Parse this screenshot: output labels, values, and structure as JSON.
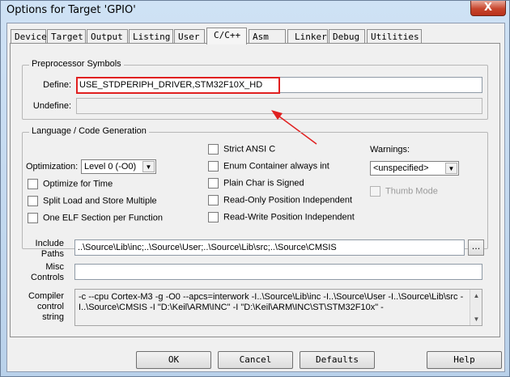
{
  "window": {
    "title": "Options for Target 'GPIO'",
    "close_glyph": "X"
  },
  "tabs": [
    {
      "label": "Device"
    },
    {
      "label": "Target"
    },
    {
      "label": "Output"
    },
    {
      "label": "Listing"
    },
    {
      "label": "User"
    },
    {
      "label": "C/C++",
      "active": true
    },
    {
      "label": "Asm"
    },
    {
      "label": "Linker"
    },
    {
      "label": "Debug"
    },
    {
      "label": "Utilities"
    }
  ],
  "preprocessor": {
    "legend": "Preprocessor Symbols",
    "define_label": "Define:",
    "define_value": "USE_STDPERIPH_DRIVER,STM32F10X_HD",
    "undefine_label": "Undefine:",
    "undefine_value": ""
  },
  "language": {
    "legend": "Language / Code Generation",
    "optimization_label": "Optimization:",
    "optimization_value": "Level 0 (-O0)",
    "optimize_time": "Optimize for Time",
    "split_load": "Split Load and Store Multiple",
    "one_elf": "One ELF Section per Function",
    "strict_ansi": "Strict ANSI C",
    "enum_container": "Enum Container always int",
    "plain_char": "Plain Char is Signed",
    "ro_pi": "Read-Only Position Independent",
    "rw_pi": "Read-Write Position Independent",
    "warnings_label": "Warnings:",
    "warnings_value": "<unspecified>",
    "thumb_mode": "Thumb Mode"
  },
  "include": {
    "label_line1": "Include",
    "label_line2": "Paths",
    "value": "..\\Source\\Lib\\inc;..\\Source\\User;..\\Source\\Lib\\src;..\\Source\\CMSIS",
    "browse_label": "..."
  },
  "misc": {
    "label_line1": "Misc",
    "label_line2": "Controls",
    "value": ""
  },
  "compiler": {
    "label_line1": "Compiler",
    "label_line2": "control",
    "label_line3": "string",
    "line1": "-c --cpu Cortex-M3 -g -O0 --apcs=interwork -I..\\Source\\Lib\\inc -I..\\Source\\User -I..\\Source\\Lib\\src -",
    "line2": "I..\\Source\\CMSIS -I \"D:\\Keil\\ARM\\INC\" -I \"D:\\Keil\\ARM\\INC\\ST\\STM32F10x\" -"
  },
  "buttons": {
    "ok": "OK",
    "cancel": "Cancel",
    "defaults": "Defaults",
    "help": "Help"
  },
  "colors": {
    "annotation": "#e02020"
  }
}
